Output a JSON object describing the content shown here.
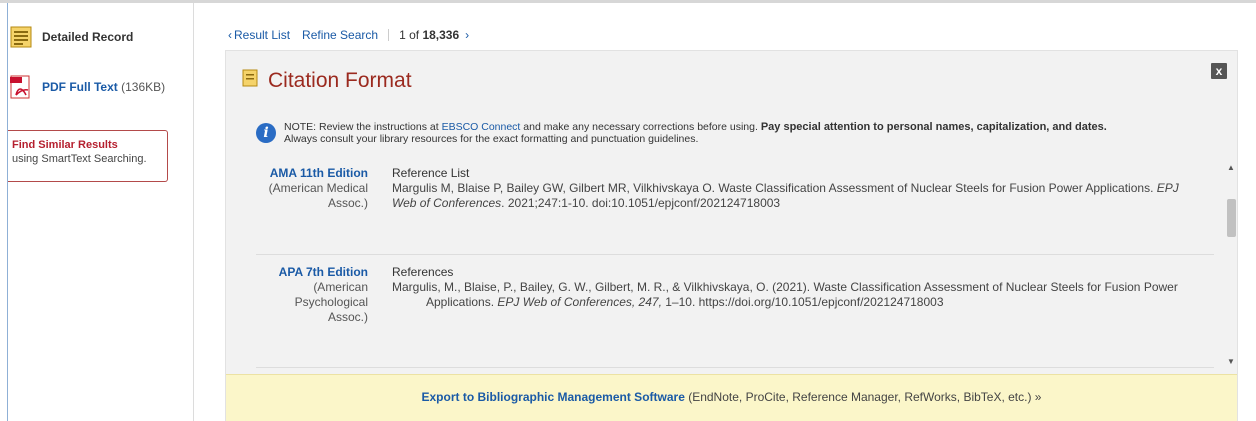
{
  "sidebar": {
    "detailed_record": "Detailed Record",
    "pdf_label": "PDF Full Text",
    "pdf_size": "(136KB)",
    "find_similar_title": "Find Similar Results",
    "find_similar_sub": "using SmartText Searching."
  },
  "topnav": {
    "result_list": "Result List",
    "refine_search": "Refine Search",
    "counter_prefix": "1 of ",
    "counter_total": "18,336",
    "prev_arrow": "‹",
    "next_arrow": "›"
  },
  "panel": {
    "title": "Citation Format",
    "close_label": "x",
    "note": {
      "prefix": "NOTE: Review the instructions at ",
      "link": "EBSCO Connect",
      "middle": " and make any necessary corrections before using. ",
      "bold": "Pay special attention to personal names, capitalization, and dates.",
      "line2": "Always consult your library resources for the exact formatting and punctuation guidelines."
    },
    "citations": [
      {
        "edition": "AMA 11th Edition",
        "publisher": "(American Medical Assoc.)",
        "heading": "Reference List",
        "text1": "Margulis M, Blaise P, Bailey GW, Gilbert MR, Vilkhivskaya O. Waste Classification Assessment of Nuclear Steels for Fusion Power Applications. ",
        "italic1": "EPJ Web of Conferences",
        "text2": ". 2021;247:1-10. doi:10.1051/epjconf/202124718003"
      },
      {
        "edition": "APA 7th Edition",
        "publisher": "(American Psychological Assoc.)",
        "heading": "References",
        "text1": "Margulis, M., Blaise, P., Bailey, G. W., Gilbert, M. R., & Vilkhivskaya, O. (2021). Waste Classification Assessment of Nuclear Steels for Fusion Power",
        "text2": "Applications. ",
        "italic1": "EPJ Web of Conferences, 247,",
        "text3": " 1–10. https://doi.org/10.1051/epjconf/202124718003"
      }
    ],
    "export": {
      "link": "Export to Bibliographic Management Software",
      "rest": " (EndNote, ProCite, Reference Manager, RefWorks, BibTeX, etc.) »"
    }
  },
  "colors": {
    "link": "#1a5aa6",
    "title": "#9b2a1f",
    "panel_bg": "#f2f2f2",
    "export_bg": "#fbf6c9"
  }
}
